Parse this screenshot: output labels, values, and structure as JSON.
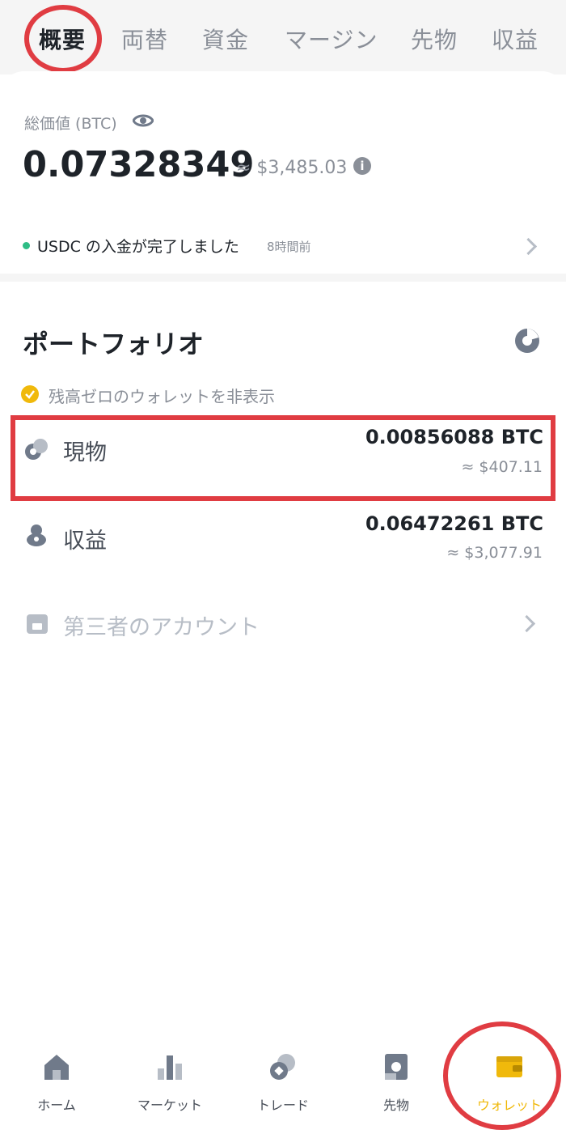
{
  "top_tabs": [
    "概要",
    "両替",
    "資金",
    "マージン",
    "先物",
    "収益"
  ],
  "total": {
    "label": "総価値 (BTC)",
    "btc_value": "0.07328349",
    "usd_value": "≈ $3,485.03",
    "info_glyph": "i"
  },
  "notice": {
    "text": "USDC の入金が完了しました",
    "time": "8時間前"
  },
  "portfolio": {
    "title": "ポートフォリオ",
    "hide_zero_label": "残高ゼロのウォレットを非表示",
    "rows": [
      {
        "label": "現物",
        "btc": "0.00856088 BTC",
        "usd": "≈ $407.11",
        "icon": "spot-icon"
      },
      {
        "label": "収益",
        "btc": "0.06472261 BTC",
        "usd": "≈ $3,077.91",
        "icon": "earn-icon"
      },
      {
        "label": "第三者のアカウント",
        "icon": "wallet-card-icon"
      }
    ]
  },
  "bottom_nav": [
    {
      "label": "ホーム",
      "icon": "home-icon"
    },
    {
      "label": "マーケット",
      "icon": "market-icon"
    },
    {
      "label": "トレード",
      "icon": "trade-icon"
    },
    {
      "label": "先物",
      "icon": "futures-icon"
    },
    {
      "label": "ウォレット",
      "icon": "wallet-icon",
      "active": true
    }
  ],
  "colors": {
    "accent": "#f0b90b",
    "annotation": "#e03c42",
    "positive": "#2ebd85",
    "muted": "#8a8f98"
  }
}
